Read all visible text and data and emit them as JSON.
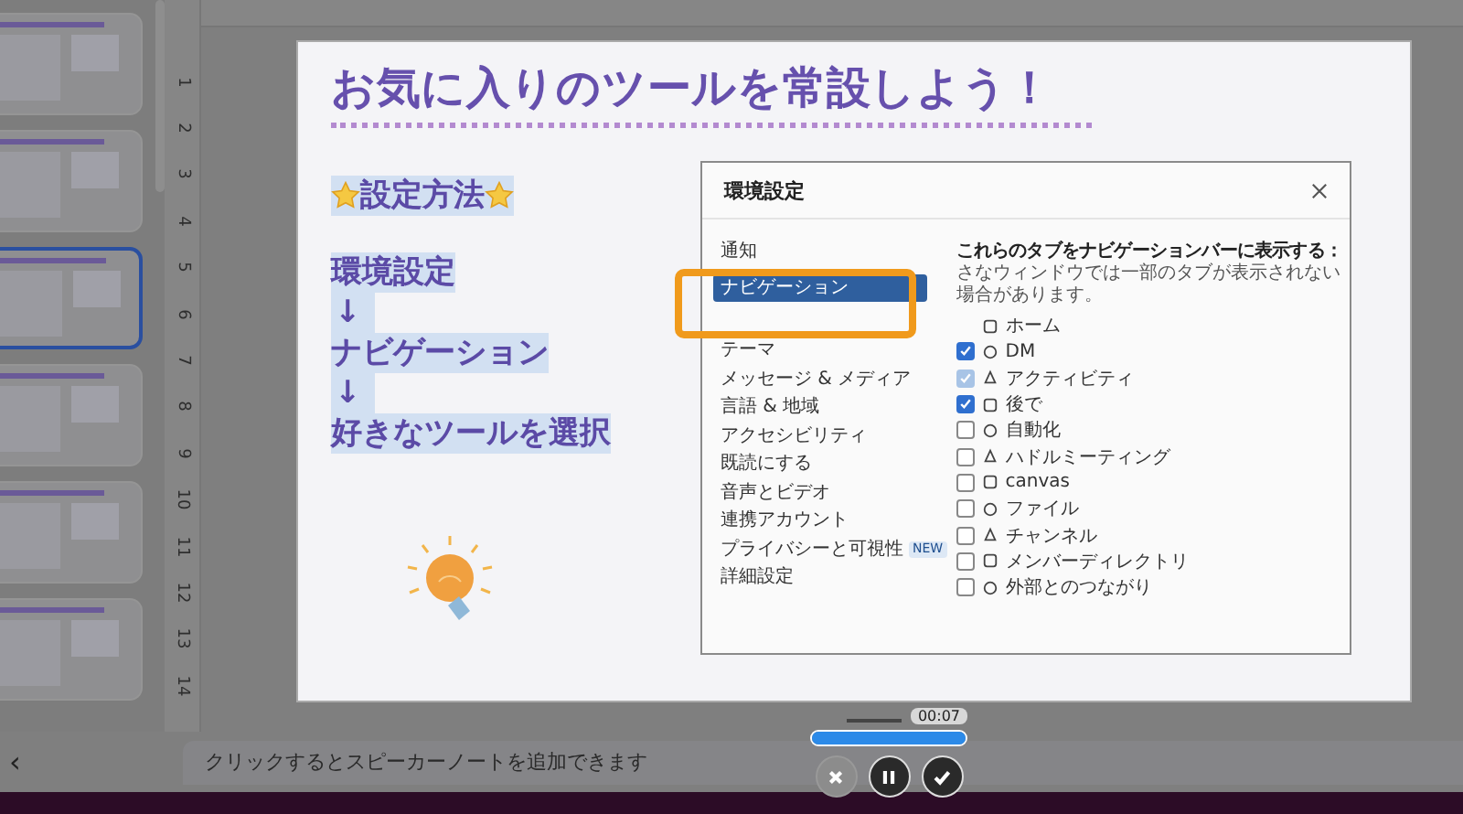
{
  "slides": [
    {
      "selected": false
    },
    {
      "selected": false
    },
    {
      "selected": true
    },
    {
      "selected": false
    },
    {
      "selected": false
    },
    {
      "selected": false
    }
  ],
  "vertical_ruler": [
    "1",
    "2",
    "3",
    "4",
    "5",
    "6",
    "7",
    "8",
    "9",
    "10",
    "11",
    "12",
    "13",
    "14"
  ],
  "slide": {
    "title": "お気に入りのツールを常設しよう！",
    "steps_heading": "設定方法",
    "steps": [
      {
        "kind": "step",
        "text": "環境設定"
      },
      {
        "kind": "arrow",
        "text": "↓"
      },
      {
        "kind": "step",
        "text": "ナビゲーション"
      },
      {
        "kind": "arrow",
        "text": "↓"
      },
      {
        "kind": "step",
        "text": "好きなツールを選択"
      }
    ],
    "dialog": {
      "title": "環境設定",
      "nav": [
        {
          "label": "通知",
          "selected": false
        },
        {
          "label": "ナビゲーション",
          "selected": true
        },
        {
          "kind": "covered"
        },
        {
          "label": "テーマ",
          "selected": false
        },
        {
          "label": "メッセージ & メディア",
          "selected": false
        },
        {
          "label": "言語 & 地域",
          "selected": false
        },
        {
          "label": "アクセシビリティ",
          "selected": false
        },
        {
          "label": "既読にする",
          "selected": false
        },
        {
          "label": "音声とビデオ",
          "selected": false
        },
        {
          "label": "連携アカウント",
          "selected": false
        },
        {
          "label": "プライバシーと可視性",
          "selected": false,
          "badge": "NEW"
        },
        {
          "label": "詳細設定",
          "selected": false
        }
      ],
      "heading": "これらのタブをナビゲーションバーに表示する：",
      "subheading": "さなウィンドウでは一部のタブが表示されない場合があります。",
      "tabs_list": [
        {
          "kind": "covered",
          "label": "ホーム"
        },
        {
          "kind": "checkbox",
          "label": "DM",
          "checked": true,
          "disabled": false
        },
        {
          "kind": "checkbox",
          "label": "アクティビティ",
          "checked": true,
          "disabled": true
        },
        {
          "kind": "checkbox",
          "label": "後で",
          "checked": true,
          "disabled": false
        },
        {
          "kind": "checkbox",
          "label": "自動化",
          "checked": false,
          "disabled": false
        },
        {
          "kind": "checkbox",
          "label": "ハドルミーティング",
          "checked": false,
          "disabled": false
        },
        {
          "kind": "checkbox",
          "label": "canvas",
          "checked": false,
          "disabled": false
        },
        {
          "kind": "checkbox",
          "label": "ファイル",
          "checked": false,
          "disabled": false
        },
        {
          "kind": "checkbox",
          "label": "チャンネル",
          "checked": false,
          "disabled": false
        },
        {
          "kind": "checkbox",
          "label": "メンバーディレクトリ",
          "checked": false,
          "disabled": false
        },
        {
          "kind": "checkbox",
          "label": "外部とのつながり",
          "checked": false,
          "disabled": false
        }
      ]
    }
  },
  "back_button": "‹",
  "notes": {
    "placeholder": "クリックするとスピーカーノートを追加できます"
  },
  "recorder": {
    "time": "00:07",
    "level": 1,
    "buttons": [
      {
        "kind": "cancel",
        "disabled": true
      },
      {
        "kind": "pause",
        "disabled": false
      },
      {
        "kind": "done",
        "disabled": false
      }
    ]
  }
}
